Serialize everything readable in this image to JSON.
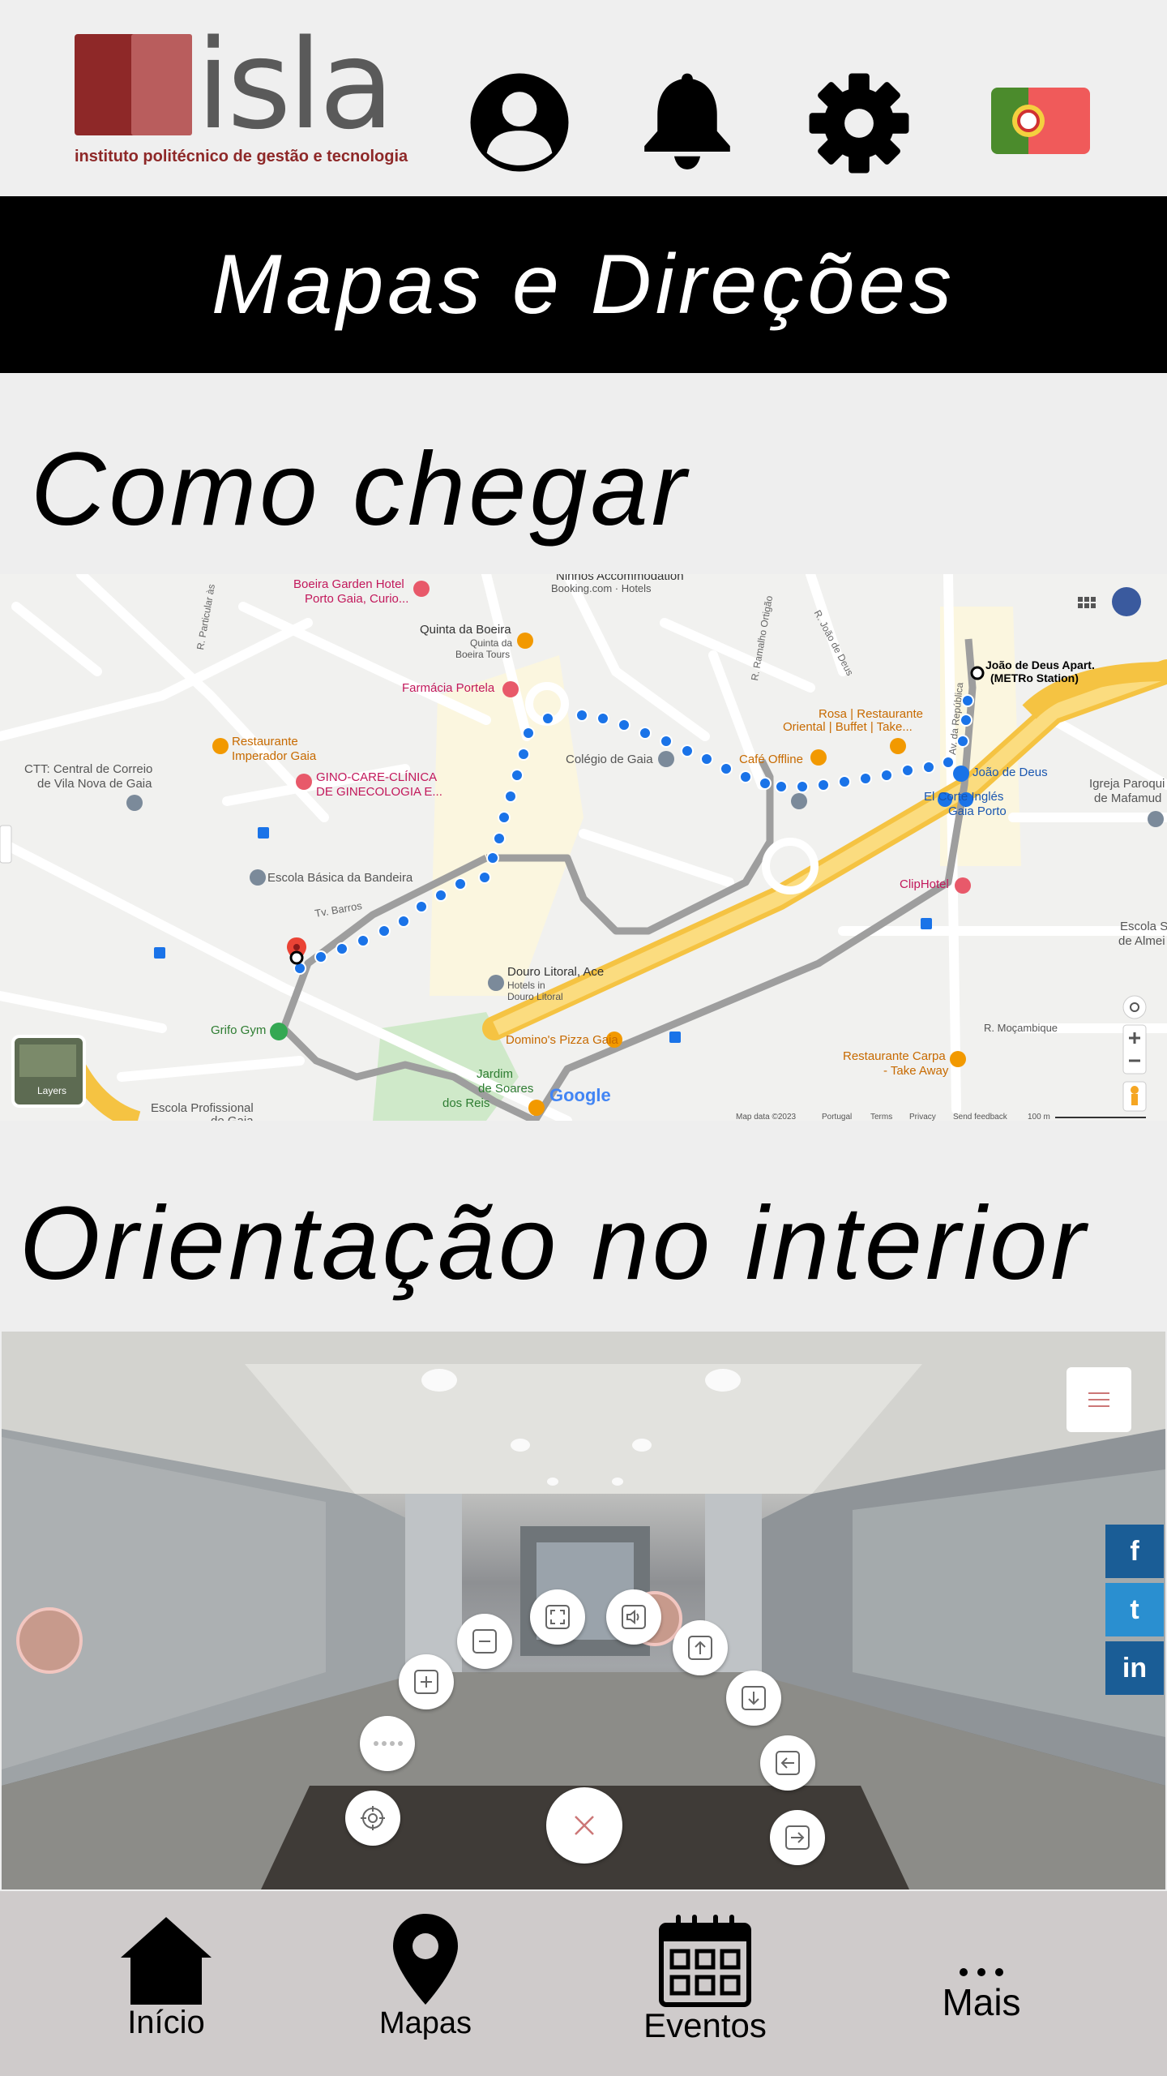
{
  "header": {
    "logo": {
      "name": "isla",
      "subtitle": "instituto politécnico de gestão e tecnologia"
    },
    "icons": [
      "user-icon",
      "bell-icon",
      "gear-icon",
      "portugal-flag-icon"
    ],
    "colors": {
      "brand": "#8e2828",
      "background": "#efefef"
    }
  },
  "title_bar": {
    "title": "Mapas e Direções"
  },
  "sections": {
    "directions_title": "Como chegar",
    "indoor_title": "Orientação no interior"
  },
  "map": {
    "places": {
      "boeira": "Boeira Garden Hotel",
      "boeira2": "Porto Gaia, Curio...",
      "ninhos": "Ninhos Accommodation",
      "booking": "Booking.com · Hotels",
      "quinta": "Quinta da Boeira",
      "quinta2": "Quinta da",
      "quinta3": "Boeira Tours",
      "farmacia": "Farmácia Portela",
      "rest_imp": "Restaurante",
      "rest_imp2": "Imperador Gaia",
      "ctt": "CTT: Central de Correio",
      "ctt2": "de Vila Nova de Gaia",
      "gino": "GINO-CARE-CLÍNICA",
      "gino2": "DE GINECOLOGIA E...",
      "colegio": "Colégio de Gaia",
      "cafe": "Café Offline",
      "rosa": "Rosa | Restaurante",
      "rosa2": "Oriental | Buffet | Take...",
      "joao_apart": "João de Deus Apart.",
      "joao_apart2": "(METRo Station)",
      "joao": "João de Deus",
      "corte": "El Corte Inglés",
      "corte2": "Gaia Porto",
      "igreja": "Igreja Paroqui",
      "igreja2": "de Mafamud",
      "escola_bandeira": "Escola Básica da Bandeira",
      "tv_barros": "Tv. Barros",
      "clip": "ClipHotel",
      "escola_s": "Escola S",
      "escola_s2": "de Almei",
      "douro": "Douro Litoral, Ace",
      "douro2": "Hotels in",
      "douro3": "Douro Litoral",
      "mocambique": "R. Moçambique",
      "dominos": "Domino's Pizza Gaia",
      "grifo": "Grifo Gym",
      "carpa": "Restaurante Carpa",
      "carpa2": "- Take Away",
      "jardim": "Jardim",
      "jardim2": "de Soares",
      "jardim3": "dos Reis",
      "escola_prof": "Escola Profissional",
      "escola_prof2": "de Gaia",
      "r_particular": "R. Particular às",
      "r_ramalho": "R. Ramalho Ortigão",
      "r_joao": "R. João de Deus",
      "av_republica": "Av. da República"
    },
    "layers_label": "Layers",
    "google_label": "Google",
    "footer": {
      "data": "Map data ©2023",
      "country": "Portugal",
      "terms": "Terms",
      "privacy": "Privacy",
      "feedback": "Send feedback",
      "scale": "100 m"
    },
    "colors": {
      "route": "#1a73e8",
      "road_major": "#f5c342",
      "road_route_alt": "#9e9e9e"
    }
  },
  "tour": {
    "controls": [
      "zoom-out",
      "fullscreen",
      "sound",
      "up",
      "zoom-in",
      "down",
      "more",
      "left",
      "target",
      "close",
      "right"
    ],
    "social": [
      "f",
      "t",
      "in"
    ],
    "colors": {
      "social": "#1a5d96"
    }
  },
  "bottom_nav": {
    "items": [
      {
        "label": "Início",
        "icon": "home-icon"
      },
      {
        "label": "Mapas",
        "icon": "map-pin-icon"
      },
      {
        "label": "Eventos",
        "icon": "calendar-icon"
      },
      {
        "label": "Mais",
        "icon": "more-icon"
      }
    ]
  }
}
